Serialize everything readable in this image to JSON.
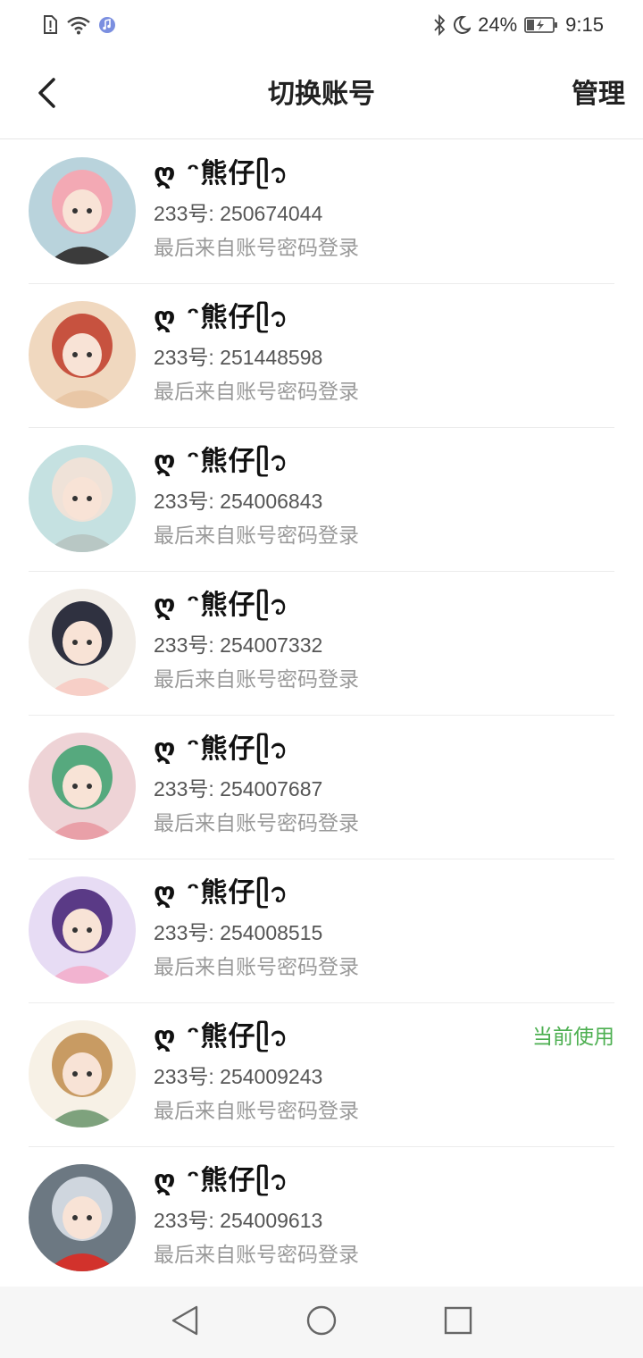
{
  "status_bar": {
    "battery_percent": "24%",
    "time": "9:15",
    "icons": [
      "sim-alert-icon",
      "wifi-icon",
      "music-icon",
      "bluetooth-icon",
      "moon-icon",
      "battery-charging-icon"
    ]
  },
  "header": {
    "title": "切换账号",
    "manage_label": "管理",
    "back_icon": "back-chevron-icon"
  },
  "accounts": [
    {
      "name": "ღ ᵔ熊仔ᥫ᭡",
      "id_text": "233号: 250674044",
      "login_text": "最后来自账号密码登录",
      "current": false,
      "avatar_colors": [
        "#b9d3dc",
        "#f3a9b4",
        "#3b3b3b"
      ]
    },
    {
      "name": "ღ ᵔ熊仔ᥫ᭡",
      "id_text": "233号: 251448598",
      "login_text": "最后来自账号密码登录",
      "current": false,
      "avatar_colors": [
        "#f0d8bf",
        "#c7523f",
        "#e9c7a6"
      ]
    },
    {
      "name": "ღ ᵔ熊仔ᥫ᭡",
      "id_text": "233号: 254006843",
      "login_text": "最后来自账号密码登录",
      "current": false,
      "avatar_colors": [
        "#c5e1e1",
        "#efe2d8",
        "#b8c7c4"
      ]
    },
    {
      "name": "ღ ᵔ熊仔ᥫ᭡",
      "id_text": "233号: 254007332",
      "login_text": "最后来自账号密码登录",
      "current": false,
      "avatar_colors": [
        "#f1ece6",
        "#2f3140",
        "#f7cfc7"
      ]
    },
    {
      "name": "ღ ᵔ熊仔ᥫ᭡",
      "id_text": "233号: 254007687",
      "login_text": "最后来自账号密码登录",
      "current": false,
      "avatar_colors": [
        "#eed3d6",
        "#56a97e",
        "#e9a0a8"
      ]
    },
    {
      "name": "ღ ᵔ熊仔ᥫ᭡",
      "id_text": "233号: 254008515",
      "login_text": "最后来自账号密码登录",
      "current": false,
      "avatar_colors": [
        "#e7dcf4",
        "#5a3a86",
        "#f2b3d0"
      ]
    },
    {
      "name": "ღ ᵔ熊仔ᥫ᭡",
      "id_text": "233号: 254009243",
      "login_text": "最后来自账号密码登录",
      "current": true,
      "current_label": "当前使用",
      "avatar_colors": [
        "#f7f1e6",
        "#c89b63",
        "#7ea27d"
      ]
    },
    {
      "name": "ღ ᵔ熊仔ᥫ᭡",
      "id_text": "233号: 254009613",
      "login_text": "最后来自账号密码登录",
      "current": false,
      "avatar_colors": [
        "#6c7882",
        "#cfd6de",
        "#d2322c"
      ]
    }
  ],
  "nav_bar": {
    "buttons": [
      "nav-back-icon",
      "nav-home-icon",
      "nav-recents-icon"
    ]
  },
  "theme": {
    "accent_green": "#4caf50",
    "secondary_text": "#9a9a9a"
  }
}
